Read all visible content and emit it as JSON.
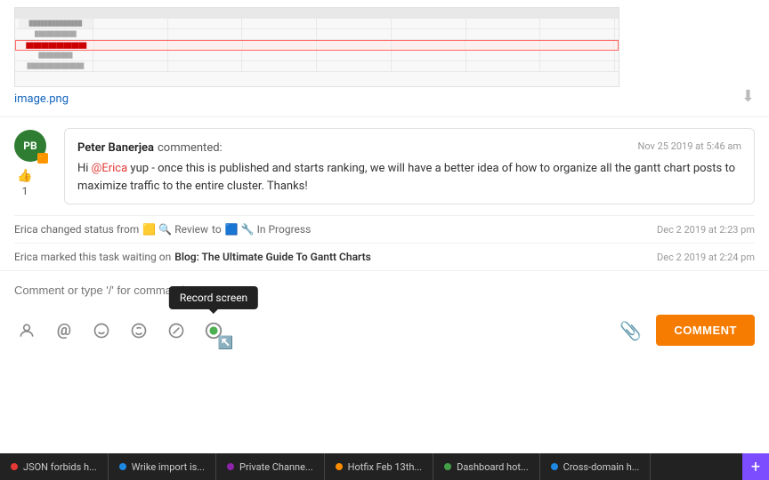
{
  "image": {
    "filename": "image.png",
    "download_tooltip": "Download"
  },
  "comment": {
    "author": "Peter Banerjea",
    "verb": "commented:",
    "timestamp": "Nov 25 2019 at 5:46 am",
    "mention": "@Erica",
    "body_before_mention": "Hi ",
    "body_after_mention": " yup - once this is published and starts ranking, we will have a better idea of how to organize all the gantt chart posts to maximize traffic to the entire cluster. Thanks!",
    "likes": "1",
    "avatar_initials": "PB"
  },
  "activity": [
    {
      "text_before": "Erica changed status from",
      "from_icon": "🟨",
      "from_emoji": "🔍",
      "from_label": "Review",
      "arrow": "to",
      "to_icon": "🟦",
      "to_emoji": "🔧",
      "to_label": "In Progress",
      "timestamp": "Dec 2 2019 at 2:23 pm"
    },
    {
      "text_before": "Erica marked this task waiting on",
      "link": "Blog: The Ultimate Guide To Gantt Charts",
      "timestamp": "Dec 2 2019 at 2:24 pm"
    }
  ],
  "input": {
    "placeholder": "Comment or type '/' for commands"
  },
  "toolbar": {
    "icons": [
      "emoji-person-icon",
      "at-icon",
      "emoji-smile-icon",
      "smiley-icon",
      "slash-icon",
      "record-icon"
    ],
    "record_tooltip": "Record screen",
    "comment_button": "COMMENT"
  },
  "taskbar": {
    "items": [
      {
        "label": "JSON forbids h...",
        "dot_color": "dot-red"
      },
      {
        "label": "Wrike import is...",
        "dot_color": "dot-blue"
      },
      {
        "label": "Private Channe...",
        "dot_color": "dot-purple"
      },
      {
        "label": "Hotfix Feb 13th...",
        "dot_color": "dot-orange"
      },
      {
        "label": "Dashboard hot...",
        "dot_color": "dot-green"
      },
      {
        "label": "Cross-domain h...",
        "dot_color": "dot-blue"
      }
    ],
    "plus_label": "+"
  }
}
